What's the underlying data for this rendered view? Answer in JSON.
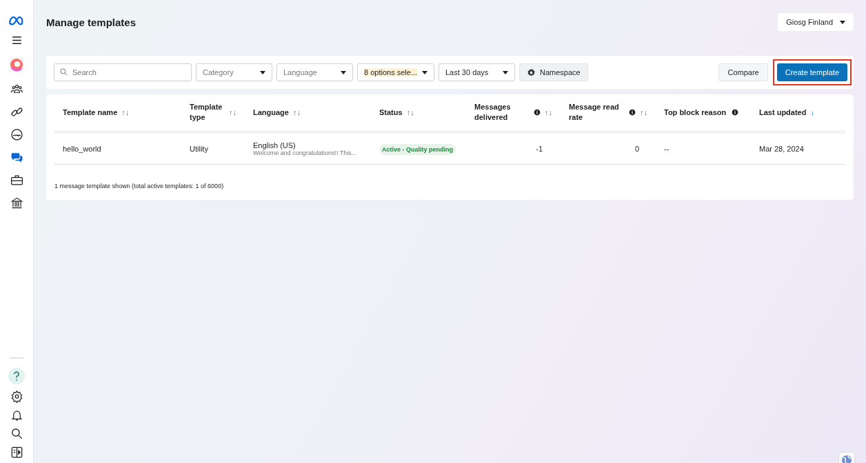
{
  "sidebar": {
    "top_items": [
      {
        "kind": "menu",
        "selected": false
      },
      {
        "kind": "app",
        "selected": false
      },
      {
        "kind": "people",
        "selected": false
      },
      {
        "kind": "link",
        "selected": false
      },
      {
        "kind": "gauge",
        "selected": false
      },
      {
        "kind": "chat",
        "selected": true
      },
      {
        "kind": "briefcase",
        "selected": false
      },
      {
        "kind": "bank",
        "selected": false
      }
    ],
    "bottom_items": [
      {
        "kind": "help",
        "selected": false
      },
      {
        "kind": "settings",
        "selected": false
      },
      {
        "kind": "bell",
        "selected": false
      },
      {
        "kind": "search",
        "selected": false
      },
      {
        "kind": "panel",
        "selected": false
      }
    ]
  },
  "page": {
    "title": "Manage templates",
    "account": "Giosg Finland"
  },
  "filters": {
    "search": {
      "placeholder": "Search"
    },
    "dropdowns": [
      {
        "kind": "placeholder",
        "label": "Category",
        "highlighted": false
      },
      {
        "kind": "placeholder",
        "label": "Language",
        "highlighted": false
      },
      {
        "kind": "value",
        "label": "8 options sele...",
        "highlighted": true
      },
      {
        "kind": "value",
        "label": "Last 30 days",
        "highlighted": false
      }
    ],
    "namespace": "Namespace",
    "compare": "Compare",
    "create": {
      "label": "Create template",
      "highlighted": true
    }
  },
  "table": {
    "columns": [
      {
        "label": "Template name",
        "sort": "↑↓",
        "active": false,
        "info": false
      },
      {
        "label": "Template type",
        "sort": "↑↓",
        "active": false,
        "info": false
      },
      {
        "label": "Language",
        "sort": "↑↓",
        "active": false,
        "info": false
      },
      {
        "label": "Status",
        "sort": "↑↓",
        "active": false,
        "info": false
      },
      {
        "label": "Messages delivered",
        "sort": "↑↓",
        "active": false,
        "info": true
      },
      {
        "label": "Message read rate",
        "sort": "↑↓",
        "active": false,
        "info": true
      },
      {
        "label": "Top block reason",
        "info": true
      },
      {
        "label": "Last updated",
        "sort": "↓",
        "active": true,
        "info": false
      }
    ],
    "rows": [
      {
        "name": "hello_world",
        "type": "Utility",
        "language": "English (US)",
        "preview": "Welcome and congratulations!! This...",
        "status": "Active - Quality pending",
        "delivered": "-1",
        "read_rate": "0",
        "block_reason": "--",
        "updated": "Mar 28, 2024"
      }
    ],
    "footer": "1 message template shown (total active templates: 1 of 6000)"
  }
}
